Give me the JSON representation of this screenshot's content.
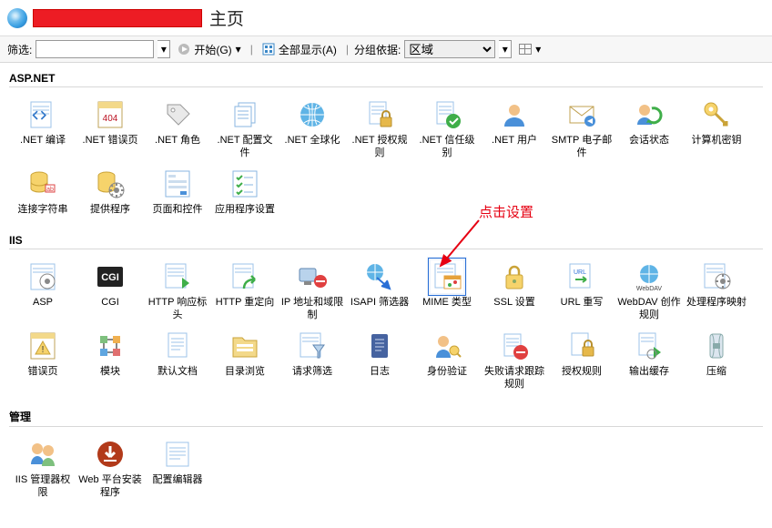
{
  "header": {
    "title": "主页"
  },
  "toolbar": {
    "filter_label": "筛选:",
    "filter_value": "",
    "start_label": "开始(G)",
    "show_all_label": "全部显示(A)",
    "group_by_label": "分组依据:",
    "group_by_value": "区域"
  },
  "annotation": {
    "text": "点击设置"
  },
  "sections": [
    {
      "title": "ASP.NET",
      "items": [
        {
          "name": "net-compile",
          "label": ".NET 编译",
          "icon": "compile"
        },
        {
          "name": "net-error-pages",
          "label": ".NET 错误页",
          "icon": "error404"
        },
        {
          "name": "net-roles",
          "label": ".NET 角色",
          "icon": "tag"
        },
        {
          "name": "net-profile",
          "label": ".NET 配置文件",
          "icon": "files"
        },
        {
          "name": "net-globalization",
          "label": ".NET 全球化",
          "icon": "globe"
        },
        {
          "name": "net-authorization",
          "label": ".NET 授权规则",
          "icon": "filelock"
        },
        {
          "name": "net-trust-levels",
          "label": ".NET 信任级别",
          "icon": "filecheck"
        },
        {
          "name": "net-users",
          "label": ".NET 用户",
          "icon": "user"
        },
        {
          "name": "smtp-email",
          "label": "SMTP 电子邮件",
          "icon": "mail"
        },
        {
          "name": "session-state",
          "label": "会话状态",
          "icon": "session"
        },
        {
          "name": "machine-key",
          "label": "计算机密钥",
          "icon": "key"
        },
        {
          "name": "connection-strings",
          "label": "连接字符串",
          "icon": "db"
        },
        {
          "name": "providers",
          "label": "提供程序",
          "icon": "provider"
        },
        {
          "name": "pages-controls",
          "label": "页面和控件",
          "icon": "pageform"
        },
        {
          "name": "app-settings",
          "label": "应用程序设置",
          "icon": "checklist"
        }
      ]
    },
    {
      "title": "IIS",
      "items": [
        {
          "name": "asp",
          "label": "ASP",
          "icon": "asp"
        },
        {
          "name": "cgi",
          "label": "CGI",
          "icon": "cgi"
        },
        {
          "name": "http-response-headers",
          "label": "HTTP 响应标头",
          "icon": "httphead"
        },
        {
          "name": "http-redirect",
          "label": "HTTP 重定向",
          "icon": "redirect"
        },
        {
          "name": "ip-domain-restrictions",
          "label": "IP 地址和域限制",
          "icon": "iprestrict"
        },
        {
          "name": "isapi-filters",
          "label": "ISAPI 筛选器",
          "icon": "isapi"
        },
        {
          "name": "mime-types",
          "label": "MIME 类型",
          "icon": "mime",
          "selected": true
        },
        {
          "name": "ssl-settings",
          "label": "SSL 设置",
          "icon": "lock"
        },
        {
          "name": "url-rewrite",
          "label": "URL 重写",
          "icon": "urlrw"
        },
        {
          "name": "webdav-authoring",
          "label": "WebDAV 创作规则",
          "icon": "webdav"
        },
        {
          "name": "handler-mappings",
          "label": "处理程序映射",
          "icon": "handler"
        },
        {
          "name": "error-pages",
          "label": "错误页",
          "icon": "errorpage"
        },
        {
          "name": "modules",
          "label": "模块",
          "icon": "modules"
        },
        {
          "name": "default-document",
          "label": "默认文档",
          "icon": "defaultdoc"
        },
        {
          "name": "directory-browsing",
          "label": "目录浏览",
          "icon": "dirbrowse"
        },
        {
          "name": "request-filtering",
          "label": "请求筛选",
          "icon": "reqfilter"
        },
        {
          "name": "logging",
          "label": "日志",
          "icon": "log"
        },
        {
          "name": "authentication",
          "label": "身份验证",
          "icon": "auth"
        },
        {
          "name": "failed-request-tracing",
          "label": "失败请求跟踪规则",
          "icon": "failtrace"
        },
        {
          "name": "authorization-rules",
          "label": "授权规则",
          "icon": "authrules"
        },
        {
          "name": "output-caching",
          "label": "输出缓存",
          "icon": "outcache"
        },
        {
          "name": "compression",
          "label": "压缩",
          "icon": "compress"
        }
      ]
    },
    {
      "title": "管理",
      "items": [
        {
          "name": "iis-manager-permissions",
          "label": "IIS 管理器权限",
          "icon": "mgrperm"
        },
        {
          "name": "web-platform-installer",
          "label": "Web 平台安装程序",
          "icon": "wpi"
        },
        {
          "name": "configuration-editor",
          "label": "配置编辑器",
          "icon": "confedit"
        }
      ]
    }
  ]
}
